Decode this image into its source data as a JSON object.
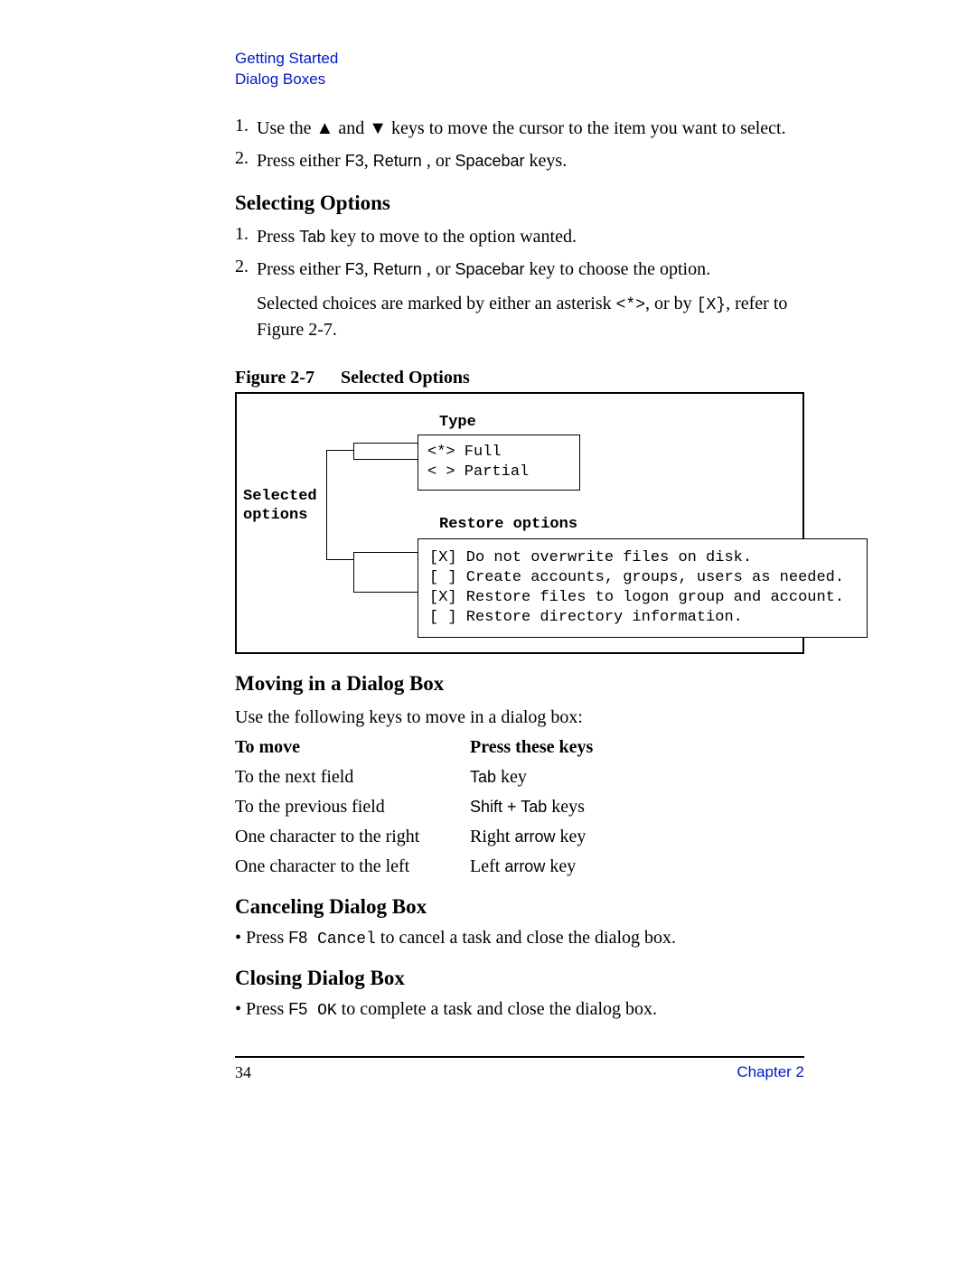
{
  "header": {
    "breadcrumb1": "Getting Started",
    "breadcrumb2": "Dialog Boxes"
  },
  "intro_list": {
    "n1": "1.",
    "item1_a": "Use the ",
    "item1_b": " and ",
    "item1_c": " keys to move the cursor to the item you want to select.",
    "n2": "2.",
    "item2_a": "Press either ",
    "f3": "F3",
    "sep1": ", ",
    "return": "Return",
    "sep2": " , or ",
    "spacebar": "Spacebar",
    "item2_b": " keys."
  },
  "selecting": {
    "heading": "Selecting Options",
    "n1": "1.",
    "item1_a": "Press ",
    "tab": "Tab",
    "item1_b": " key to move to the option wanted.",
    "n2": "2.",
    "item2_a": "Press either ",
    "f3": "F3",
    "sep1": ", ",
    "return": "Return",
    "sep2": " , or ",
    "spacebar": "Spacebar",
    "item2_b": " key to choose the option.",
    "note_a": "Selected choices are marked by either an asterisk ",
    "ast": "<*>",
    "note_b": ", or by ",
    "x": "[X}",
    "note_c": ", refer to Figure 2-7."
  },
  "figure": {
    "label": "Figure 2-7",
    "title": "Selected Options",
    "side_label_1": "Selected",
    "side_label_2": "options",
    "type_heading": "Type",
    "type_opt1": "<*> Full",
    "type_opt2": "< > Partial",
    "restore_heading": "Restore options",
    "r1": "[X] Do not overwrite files on disk.",
    "r2": "[ ] Create accounts, groups, users as needed.",
    "r3": "[X] Restore files to logon group and account.",
    "r4": "[ ] Restore directory information."
  },
  "moving": {
    "heading": "Moving in a Dialog Box",
    "intro": "Use the following keys to move in a dialog box:",
    "h1": "To move",
    "h2": "Press these keys",
    "rows": [
      {
        "move": "To the next field",
        "key_a": "Tab",
        "key_b": " key"
      },
      {
        "move": "To the previous field",
        "key_a": "Shift",
        "plus": " + ",
        "key_a2": "Tab",
        "key_b": " keys"
      },
      {
        "move": "One character to the right",
        "key_a": "Right ",
        "key_a2": "arrow",
        "key_b": " key"
      },
      {
        "move": "One character to the left",
        "key_a": "Left ",
        "key_a2": "arrow",
        "key_b": " key"
      }
    ]
  },
  "canceling": {
    "heading": "Canceling Dialog Box",
    "a": "Press ",
    "f8": "F8",
    "cancel": " Cancel",
    "b": " to cancel a task and close the dialog box."
  },
  "closing": {
    "heading": "Closing Dialog Box",
    "a": "Press ",
    "f5": "F5",
    "ok": " OK",
    "b": " to complete a task and close the dialog box."
  },
  "footer": {
    "page": "34",
    "chapter": "Chapter 2"
  }
}
